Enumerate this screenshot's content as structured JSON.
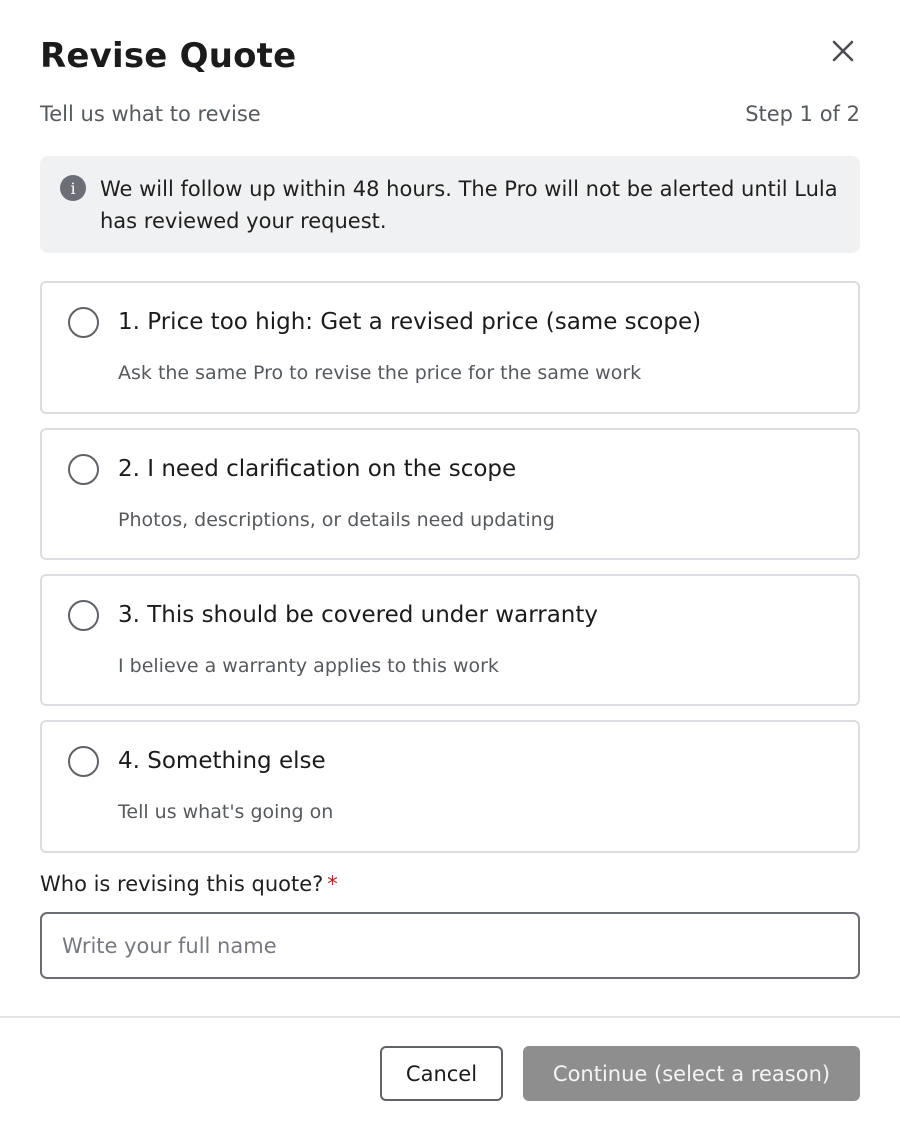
{
  "modal": {
    "title": "Revise Quote",
    "subtitle": "Tell us what to revise",
    "step": "Step 1 of 2",
    "close_icon": "close-icon"
  },
  "info": {
    "icon": "info-icon",
    "icon_glyph": "i",
    "text": "We will follow up within 48 hours. The Pro will not be alerted until Lula has reviewed your request."
  },
  "options": [
    {
      "title": "1. Price too high: Get a revised price (same scope)",
      "description": "Ask the same Pro to revise the price for the same work",
      "selected": false
    },
    {
      "title": "2. I need clarification on the scope",
      "description": "Photos, descriptions, or details need updating",
      "selected": false
    },
    {
      "title": "3. This should be covered under warranty",
      "description": "I believe a warranty applies to this work",
      "selected": false
    },
    {
      "title": "4. Something else",
      "description": "Tell us what's going on",
      "selected": false
    }
  ],
  "reviser": {
    "label": "Who is revising this quote?",
    "required_mark": "*",
    "placeholder": "Write your full name",
    "value": ""
  },
  "footer": {
    "cancel_label": "Cancel",
    "continue_label": "Continue (select a reason)",
    "continue_color": "#8e8e8e"
  }
}
